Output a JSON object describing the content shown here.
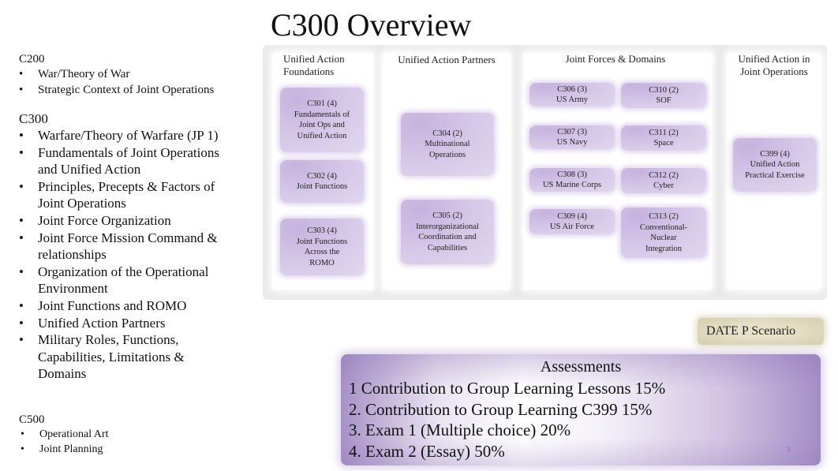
{
  "title": "C300 Overview",
  "outline": {
    "c200": {
      "heading": "C200",
      "items": [
        "War/Theory of War",
        "Strategic Context of Joint Operations"
      ]
    },
    "c300": {
      "heading": "C300",
      "items": [
        "Warfare/Theory of Warfare (JP 1)",
        "Fundamentals of Joint Operations and Unified Action",
        "Principles, Precepts & Factors of Joint Operations",
        "Joint Force Organization",
        "Joint Force Mission Command & relationships",
        "Organization of the Operational Environment",
        "Joint Functions and ROMO",
        "Unified Action Partners",
        "Military Roles, Functions, Capabilities, Limitations & Domains"
      ]
    },
    "c500": {
      "heading": "C500",
      "items": [
        "Operational Art",
        "Joint Planning"
      ]
    },
    "bullet": "•"
  },
  "diagram": {
    "columns": [
      {
        "heading": "Unified Action Foundations",
        "boxes": [
          {
            "code": "C301 (4)",
            "name": "Fundamentals of Joint Ops and Unified Action"
          },
          {
            "code": "C302 (4)",
            "name": "Joint Functions"
          },
          {
            "code": "C303 (4)",
            "name": "Joint Functions Across the ROMO"
          }
        ]
      },
      {
        "heading": "Unified Action Partners",
        "boxes": [
          {
            "code": "C304 (2)",
            "name": "Multinational Operations"
          },
          {
            "code": "C305 (2)",
            "name": "Interorganizational Coordination and Capabilities"
          }
        ]
      },
      {
        "heading": "Joint Forces & Domains",
        "boxes": [
          {
            "code": "C306 (3)",
            "name": "US Army"
          },
          {
            "code": "C307 (3)",
            "name": "US Navy"
          },
          {
            "code": "C308 (3)",
            "name": "US Marine Corps"
          },
          {
            "code": "C309 (4)",
            "name": "US Air Force"
          },
          {
            "code": "C310 (2)",
            "name": "SOF"
          },
          {
            "code": "C311 (2)",
            "name": "Space"
          },
          {
            "code": "C312 (2)",
            "name": "Cyber"
          },
          {
            "code": "C313 (2)",
            "name": "Conventional-Nuclear Integration"
          }
        ]
      },
      {
        "heading": "Unified Action in Joint Operations",
        "boxes": [
          {
            "code": "C399 (4)",
            "name": "Unified Action Practical Exercise"
          }
        ]
      }
    ]
  },
  "date_p": "DATE P Scenario",
  "assessments": {
    "title": "Assessments",
    "items": [
      "1 Contribution to Group Learning Lessons 15%",
      "2. Contribution to Group Learning C399 15%",
      "3. Exam 1 (Multiple choice) 20%",
      "4. Exam 2 (Essay) 50%"
    ]
  },
  "slide_number": "3",
  "colors": {
    "box_purple": "#d6c9e8",
    "assessment_purple": "#a791c6",
    "date_p_tan": "#d4ceae"
  }
}
